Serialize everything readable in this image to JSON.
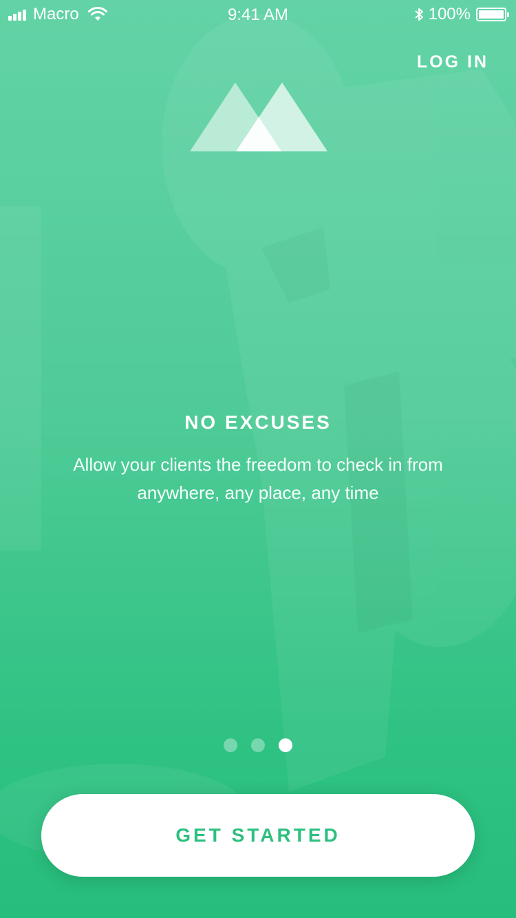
{
  "status_bar": {
    "carrier": "Macro",
    "time": "9:41 AM",
    "battery": "100%",
    "icons": [
      "signal-icon",
      "wifi-icon",
      "bluetooth-icon",
      "battery-icon"
    ]
  },
  "header": {
    "login_label": "LOG IN",
    "logo_icon": "mountains-logo-icon"
  },
  "slide": {
    "title": "NO EXCUSES",
    "description": "Allow your clients the freedom to check in from anywhere, any place, any time"
  },
  "pager": {
    "total": 3,
    "active_index": 2
  },
  "cta": {
    "label": "GET STARTED"
  },
  "colors": {
    "gradient_top": "#63d3a6",
    "gradient_bottom": "#27bd7d",
    "accent": "#2cc07f",
    "text": "#ffffff"
  }
}
